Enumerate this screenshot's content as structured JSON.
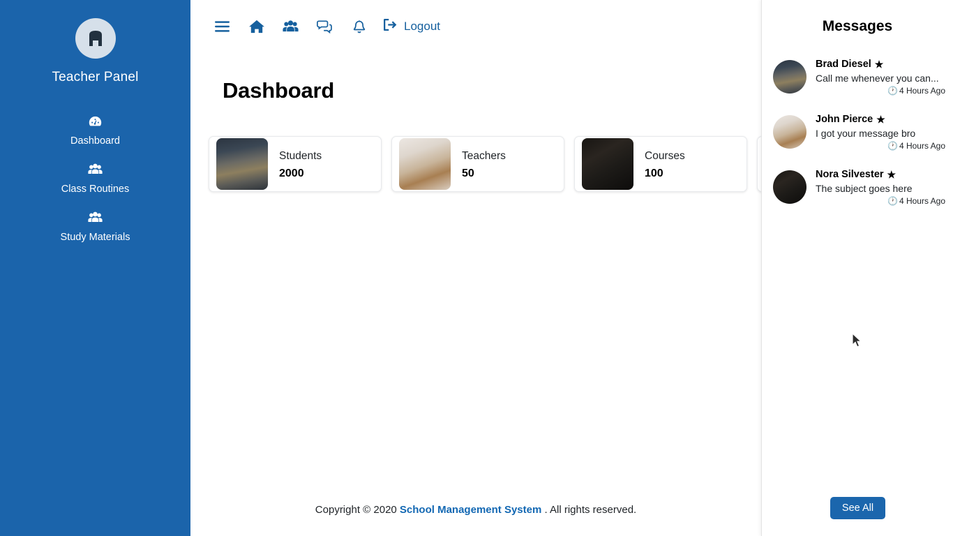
{
  "sidebar": {
    "logo_icon": "teacher-logo-icon",
    "brand_title": "Teacher Panel",
    "items": [
      {
        "label": "Dashboard",
        "icon": "tachometer-icon"
      },
      {
        "label": "Class Routines",
        "icon": "users-icon"
      },
      {
        "label": "Study Materials",
        "icon": "users-icon"
      }
    ]
  },
  "navbar": {
    "buttons": [
      {
        "icon": "hamburger-menu-icon",
        "name": "menu-toggle"
      },
      {
        "icon": "home-icon",
        "name": "home-link"
      },
      {
        "icon": "users-icon",
        "name": "users-link"
      },
      {
        "icon": "comments-icon",
        "name": "messages-link"
      },
      {
        "icon": "bell-icon",
        "name": "notifications-link"
      }
    ],
    "logout_label": "Logout",
    "logout_icon": "sign-out-icon"
  },
  "main": {
    "page_title": "Dashboard",
    "cards": [
      {
        "label": "Students",
        "value": "2000",
        "thumb": "alley-photo"
      },
      {
        "label": "Teachers",
        "value": "50",
        "thumb": "dining-room-photo"
      },
      {
        "label": "Courses",
        "value": "100",
        "thumb": "woman-reading-photo"
      },
      {
        "label": "",
        "value": "",
        "thumb": "person-photo"
      }
    ]
  },
  "footer": {
    "prefix": "Copyright © 2020",
    "link": "School Management System",
    "suffix": ". All rights reserved."
  },
  "messages": {
    "title": "Messages",
    "see_all_label": "See All",
    "items": [
      {
        "name": "Brad Diesel",
        "star": "★",
        "preview": "Call me whenever you can...",
        "time": "4 Hours Ago",
        "avatar": "alley-photo"
      },
      {
        "name": "John Pierce",
        "star": "★",
        "preview": "I got your message bro",
        "time": "4 Hours Ago",
        "avatar": "dining-room-photo"
      },
      {
        "name": "Nora Silvester",
        "star": "★",
        "preview": "The subject goes here",
        "time": "4 Hours Ago",
        "avatar": "woman-reading-photo"
      }
    ]
  },
  "colors": {
    "sidebar_blue": "#1b64ab",
    "accent_blue": "#16609e",
    "link_blue": "#1368b3",
    "button_blue": "#1b66ad"
  }
}
